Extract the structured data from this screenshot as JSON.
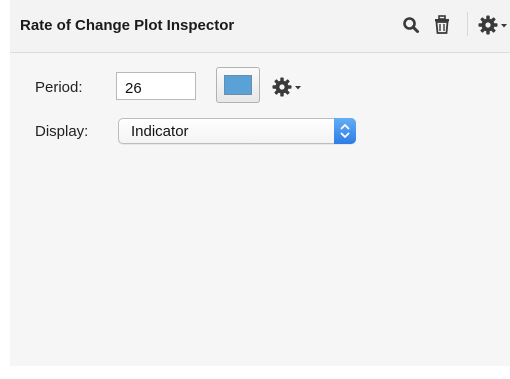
{
  "inspector": {
    "title": "Rate of Change Plot Inspector"
  },
  "header_icons": [
    "search-icon",
    "trash-icon",
    "gear-menu-icon"
  ],
  "period": {
    "label": "Period:",
    "value": "26"
  },
  "plot_color": "#5aa1d8",
  "display": {
    "label": "Display:",
    "selected": "Indicator"
  },
  "colors": {
    "accent": "#2d7de6",
    "panel_bg": "#f6f6f6"
  }
}
